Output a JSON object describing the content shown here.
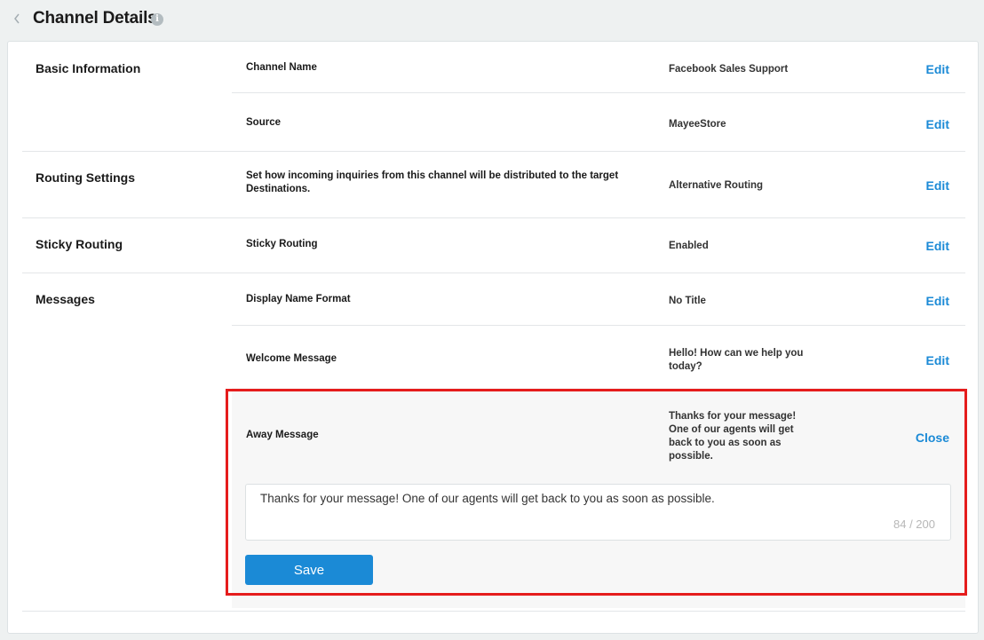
{
  "header": {
    "title": "Channel Details"
  },
  "sections": {
    "basic": "Basic Information",
    "routing": "Routing Settings",
    "sticky": "Sticky Routing",
    "messages": "Messages"
  },
  "fields": {
    "channel_name": {
      "label": "Channel Name",
      "value": "Facebook Sales Support",
      "action": "Edit"
    },
    "source": {
      "label": "Source",
      "value": "MayeeStore",
      "action": "Edit"
    },
    "routing": {
      "label": "Set how incoming inquiries from this channel will be distributed to the target Destinations.",
      "value": "Alternative Routing",
      "action": "Edit"
    },
    "sticky": {
      "label": "Sticky Routing",
      "value": "Enabled",
      "action": "Edit"
    },
    "display_name": {
      "label": "Display Name Format",
      "value": "No Title",
      "action": "Edit"
    },
    "welcome": {
      "label": "Welcome Message",
      "value": "Hello! How can we help you today?",
      "action": "Edit"
    },
    "away": {
      "label": "Away Message",
      "value": "Thanks for your message! One of our agents will get back to you as soon as possible.",
      "action": "Close"
    }
  },
  "editor": {
    "text": "Thanks for your message! One of our agents will get back to you as soon as possible.",
    "counter": "84 / 200",
    "save_label": "Save"
  },
  "colors": {
    "accent": "#1b8ad6",
    "highlight": "#e51c1c"
  }
}
